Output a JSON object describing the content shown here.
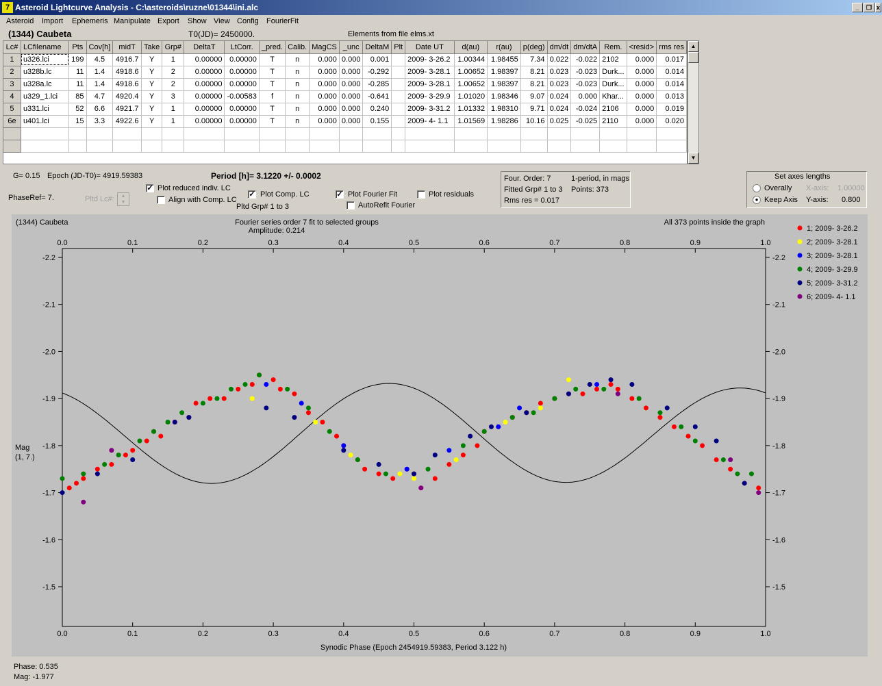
{
  "window": {
    "title": "Asteroid Lightcurve Analysis - C:\\asteroids\\ruzne\\01344\\ini.alc",
    "icon_text": "7"
  },
  "menu": [
    "Asteroid",
    "Import",
    "Ephemeris",
    "Manipulate",
    "Export",
    "Show",
    "View",
    "Config",
    "FourierFit"
  ],
  "header": {
    "asteroid": "(1344) Caubeta",
    "t0": "T0(JD)= 2450000.",
    "elements": "Elements from file elms.xt"
  },
  "table": {
    "columns": [
      "Lc#",
      "LCfilename",
      "Pts",
      "Cov[h]",
      "midT",
      "Take",
      "Grp#",
      "DeltaT",
      "LtCorr.",
      "_pred.",
      "Calib.",
      "MagCS",
      "_unc",
      "DeltaM",
      "Plt",
      "Date UT",
      "d(au)",
      "r(au)",
      "p(deg)",
      "dm/dt",
      "dm/dtA",
      "Rem.",
      "<resid>",
      "rms res"
    ],
    "rows": [
      [
        "1",
        "u326.lci",
        "199",
        "4.5",
        "4916.7",
        "Y",
        "1",
        "0.00000",
        "0.00000",
        "T",
        "n",
        "0.000",
        "0.000",
        "0.001",
        "",
        "2009- 3-26.2",
        "1.00344",
        "1.98455",
        "7.34",
        "0.022",
        "-0.022",
        "2102",
        "0.000",
        "0.017"
      ],
      [
        "2",
        "u328b.lc",
        "11",
        "1.4",
        "4918.6",
        "Y",
        "2",
        "0.00000",
        "0.00000",
        "T",
        "n",
        "0.000",
        "0.000",
        "-0.292",
        "",
        "2009- 3-28.1",
        "1.00652",
        "1.98397",
        "8.21",
        "0.023",
        "-0.023",
        "Durk...",
        "0.000",
        "0.014"
      ],
      [
        "3",
        "u328a.lc",
        "11",
        "1.4",
        "4918.6",
        "Y",
        "2",
        "0.00000",
        "0.00000",
        "T",
        "n",
        "0.000",
        "0.000",
        "-0.285",
        "",
        "2009- 3-28.1",
        "1.00652",
        "1.98397",
        "8.21",
        "0.023",
        "-0.023",
        "Durk...",
        "0.000",
        "0.014"
      ],
      [
        "4",
        "u329_1.lci",
        "85",
        "4.7",
        "4920.4",
        "Y",
        "3",
        "0.00000",
        "-0.00583",
        "f",
        "n",
        "0.000",
        "0.000",
        "-0.641",
        "",
        "2009- 3-29.9",
        "1.01020",
        "1.98346",
        "9.07",
        "0.024",
        "0.000",
        "Khar...",
        "0.000",
        "0.013"
      ],
      [
        "5",
        "u331.lci",
        "52",
        "6.6",
        "4921.7",
        "Y",
        "1",
        "0.00000",
        "0.00000",
        "T",
        "n",
        "0.000",
        "0.000",
        "0.240",
        "",
        "2009- 3-31.2",
        "1.01332",
        "1.98310",
        "9.71",
        "0.024",
        "-0.024",
        "2106",
        "0.000",
        "0.019"
      ],
      [
        "6e",
        "u401.lci",
        "15",
        "3.3",
        "4922.6",
        "Y",
        "1",
        "0.00000",
        "0.00000",
        "T",
        "n",
        "0.000",
        "0.000",
        "0.155",
        "",
        "2009- 4- 1.1",
        "1.01569",
        "1.98286",
        "10.16",
        "0.025",
        "-0.025",
        "2110",
        "0.000",
        "0.020"
      ]
    ]
  },
  "controls": {
    "g": "G= 0.15",
    "epoch": "Epoch (JD-T0)= 4919.59383",
    "period": "Period [h]= 3.1220 +/- 0.0002",
    "phaseref": "PhaseRef= 7.",
    "pltd_lc": "Pltd Lc#:",
    "plot_reduced": "Plot reduced indiv. LC",
    "align_comp": "Align with Comp. LC",
    "plot_comp": "Plot Comp. LC",
    "pltd_grp": "Pltd Grp#  1   to    3",
    "plot_fourier": "Plot Fourier Fit",
    "autorefit": "AutoRefit Fourier",
    "plot_residuals": "Plot residuals",
    "four_order": "Four. Order:  7",
    "one_period": "1-period, in mags",
    "fitted_grp": "Fitted Grp# 1 to 3",
    "points": "Points: 373",
    "rms": "Rms res      = 0.017",
    "axes_title": "Set axes lengths",
    "overally": "Overally",
    "keep_axis": "Keep Axis",
    "xaxis_label": "X-axis:",
    "xaxis_val": "1.00000",
    "yaxis_label": "Y-axis:",
    "yaxis_val": "0.800"
  },
  "status": {
    "phase": "Phase:  0.535",
    "mag": "Mag:    -1.977"
  },
  "chart_data": {
    "type": "scatter",
    "title": "(1344) Caubeta",
    "subtitle": "Fourier series order 7 fit to selected groups",
    "amplitude": "Amplitude: 0.214",
    "note": "All 373 points inside the graph",
    "xlabel": "Synodic Phase (Epoch 2454919.59383, Period 3.122 h)",
    "ylabel": "Mag",
    "ylabel2": "(1, 7.)",
    "xlim": [
      0,
      1
    ],
    "ylim": [
      -2.2,
      -1.5
    ],
    "y_inverted": true,
    "xticks": [
      "0.0",
      "0.1",
      "0.2",
      "0.3",
      "0.4",
      "0.5",
      "0.6",
      "0.7",
      "0.8",
      "0.9",
      "1.0"
    ],
    "yticks": [
      "-2.2",
      "-2.1",
      "-2.0",
      "-1.9",
      "-1.8",
      "-1.7",
      "-1.6",
      "-1.5"
    ],
    "fourier_fit": {
      "a0": -1.824,
      "a1": 0.005,
      "b1": 0.0,
      "a2": -0.093,
      "b2": 0.045
    },
    "series": [
      {
        "name": "1; 2009- 3-26.2",
        "color": "#ff0000",
        "x": [
          0.01,
          0.02,
          0.03,
          0.05,
          0.07,
          0.09,
          0.1,
          0.12,
          0.13,
          0.14,
          0.16,
          0.18,
          0.19,
          0.21,
          0.23,
          0.25,
          0.27,
          0.28,
          0.3,
          0.31,
          0.33,
          0.35,
          0.37,
          0.39,
          0.4,
          0.42,
          0.43,
          0.45,
          0.47,
          0.49,
          0.5,
          0.51,
          0.53,
          0.55,
          0.57,
          0.59,
          0.6,
          0.62,
          0.64,
          0.66,
          0.68,
          0.7,
          0.72,
          0.74,
          0.76,
          0.78,
          0.79,
          0.81,
          0.83,
          0.85,
          0.87,
          0.89,
          0.91,
          0.93,
          0.95,
          0.97,
          0.99
        ],
        "y": [
          -1.71,
          -1.72,
          -1.73,
          -1.75,
          -1.76,
          -1.78,
          -1.79,
          -1.81,
          -1.83,
          -1.82,
          -1.85,
          -1.86,
          -1.89,
          -1.9,
          -1.9,
          -1.92,
          -1.93,
          -1.95,
          -1.94,
          -1.92,
          -1.91,
          -1.87,
          -1.85,
          -1.82,
          -1.8,
          -1.77,
          -1.75,
          -1.74,
          -1.73,
          -1.75,
          -1.74,
          -1.71,
          -1.73,
          -1.76,
          -1.78,
          -1.8,
          -1.83,
          -1.84,
          -1.86,
          -1.87,
          -1.89,
          -1.9,
          -1.91,
          -1.91,
          -1.92,
          -1.93,
          -1.92,
          -1.9,
          -1.88,
          -1.86,
          -1.84,
          -1.82,
          -1.8,
          -1.77,
          -1.75,
          -1.72,
          -1.71
        ]
      },
      {
        "name": "2; 2009- 3-28.1",
        "color": "#ffff00",
        "x": [
          0.27,
          0.36,
          0.41,
          0.48,
          0.5,
          0.56,
          0.63,
          0.68,
          0.72
        ],
        "y": [
          -1.9,
          -1.85,
          -1.78,
          -1.74,
          -1.73,
          -1.77,
          -1.85,
          -1.88,
          -1.94
        ]
      },
      {
        "name": "3; 2009- 3-28.1",
        "color": "#0000ff",
        "x": [
          0.29,
          0.34,
          0.4,
          0.49,
          0.55,
          0.62,
          0.65,
          0.76
        ],
        "y": [
          -1.93,
          -1.89,
          -1.8,
          -1.75,
          -1.79,
          -1.84,
          -1.88,
          -1.93
        ]
      },
      {
        "name": "4; 2009- 3-29.9",
        "color": "#008000",
        "x": [
          0.0,
          0.03,
          0.06,
          0.08,
          0.11,
          0.13,
          0.15,
          0.17,
          0.2,
          0.22,
          0.24,
          0.26,
          0.28,
          0.32,
          0.35,
          0.38,
          0.42,
          0.46,
          0.52,
          0.57,
          0.6,
          0.64,
          0.67,
          0.7,
          0.73,
          0.77,
          0.82,
          0.85,
          0.88,
          0.9,
          0.94,
          0.96,
          0.98
        ],
        "y": [
          -1.73,
          -1.74,
          -1.76,
          -1.78,
          -1.81,
          -1.83,
          -1.85,
          -1.87,
          -1.89,
          -1.9,
          -1.92,
          -1.93,
          -1.95,
          -1.92,
          -1.88,
          -1.83,
          -1.77,
          -1.74,
          -1.75,
          -1.8,
          -1.83,
          -1.86,
          -1.87,
          -1.9,
          -1.92,
          -1.92,
          -1.9,
          -1.87,
          -1.84,
          -1.81,
          -1.77,
          -1.74,
          -1.74
        ]
      },
      {
        "name": "5; 2009- 3-31.2",
        "color": "#000080",
        "x": [
          0.0,
          0.05,
          0.1,
          0.16,
          0.18,
          0.29,
          0.33,
          0.4,
          0.45,
          0.5,
          0.53,
          0.58,
          0.61,
          0.66,
          0.72,
          0.75,
          0.78,
          0.81,
          0.86,
          0.9,
          0.93,
          0.97
        ],
        "y": [
          -1.7,
          -1.74,
          -1.77,
          -1.85,
          -1.86,
          -1.88,
          -1.86,
          -1.79,
          -1.76,
          -1.74,
          -1.78,
          -1.82,
          -1.84,
          -1.87,
          -1.91,
          -1.93,
          -1.94,
          -1.93,
          -1.88,
          -1.84,
          -1.81,
          -1.72
        ]
      },
      {
        "name": "6; 2009- 4- 1.1",
        "color": "#800080",
        "x": [
          0.03,
          0.07,
          0.51,
          0.79,
          0.95,
          0.99
        ],
        "y": [
          -1.68,
          -1.79,
          -1.71,
          -1.91,
          -1.77,
          -1.7
        ]
      }
    ]
  }
}
